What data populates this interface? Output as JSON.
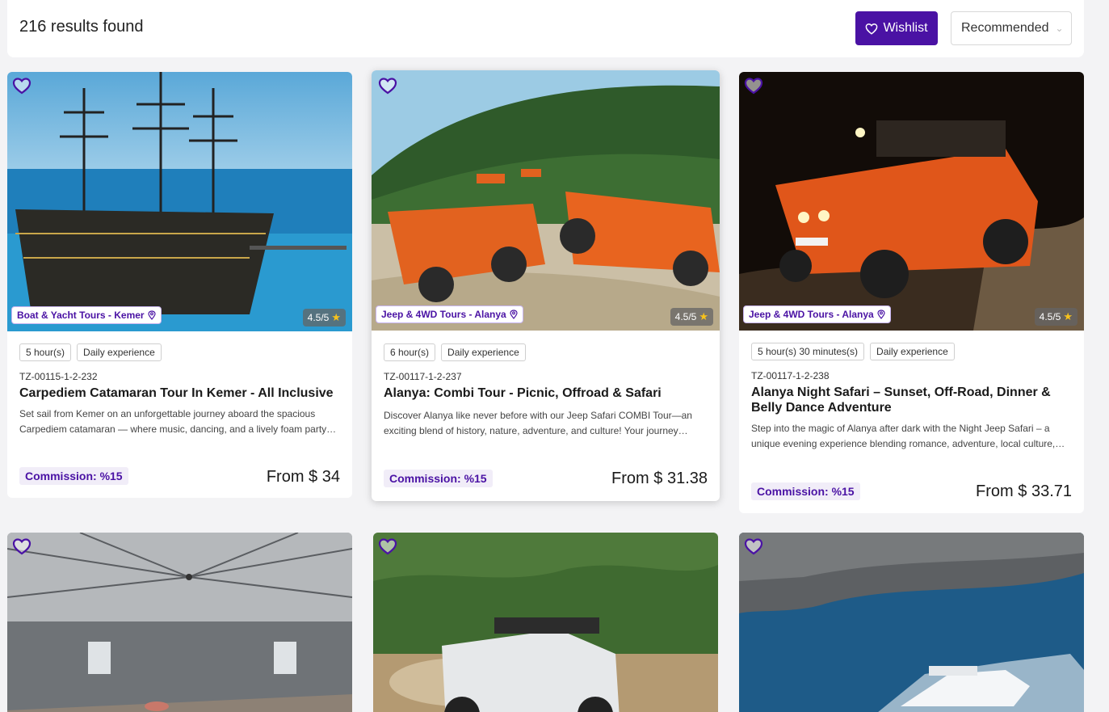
{
  "header": {
    "results_text": "216 results found",
    "wishlist_label": "Wishlist",
    "sort_value": "Recommended"
  },
  "colors": {
    "accent": "#4a12a4",
    "commission_bg": "#f1edf8"
  },
  "icons": [
    "heart-icon",
    "location-pin-icon",
    "star-icon",
    "chevron-down-icon"
  ],
  "tours": [
    {
      "category": "Boat & Yacht Tours - Kemer",
      "rating": "4.5/5",
      "tags": [
        "5 hour(s)",
        "Daily experience"
      ],
      "code": "TZ-00115-1-2-232",
      "title": "Carpediem Catamaran Tour In Kemer - All Inclusive",
      "description": "Set sail from Kemer on an unforgettable journey aboard the spacious Carpediem catamaran — where music, dancing, and a lively foam party…",
      "commission": "Commission: %15",
      "price": "From $ 34"
    },
    {
      "category": "Jeep & 4WD Tours - Alanya",
      "rating": "4.5/5",
      "tags": [
        "6 hour(s)",
        "Daily experience"
      ],
      "code": "TZ-00117-1-2-237",
      "title": "Alanya: Combi Tour - Picnic, Offroad & Safari",
      "description": "Discover Alanya like never before with our Jeep Safari COMBI Tour—an exciting blend of history, nature, adventure, and culture! Your journey…",
      "commission": "Commission: %15",
      "price": "From $ 31.38"
    },
    {
      "category": "Jeep & 4WD Tours - Alanya",
      "rating": "4.5/5",
      "tags": [
        "5 hour(s) 30 minutes(s)",
        "Daily experience"
      ],
      "code": "TZ-00117-1-2-238",
      "title": "Alanya Night Safari – Sunset, Off-Road, Dinner & Belly Dance Adventure",
      "description": "Step into the magic of Alanya after dark with the Night Jeep Safari – a unique evening experience blending romance, adventure, local culture, an…",
      "commission": "Commission: %15",
      "price": "From $ 33.71"
    }
  ]
}
